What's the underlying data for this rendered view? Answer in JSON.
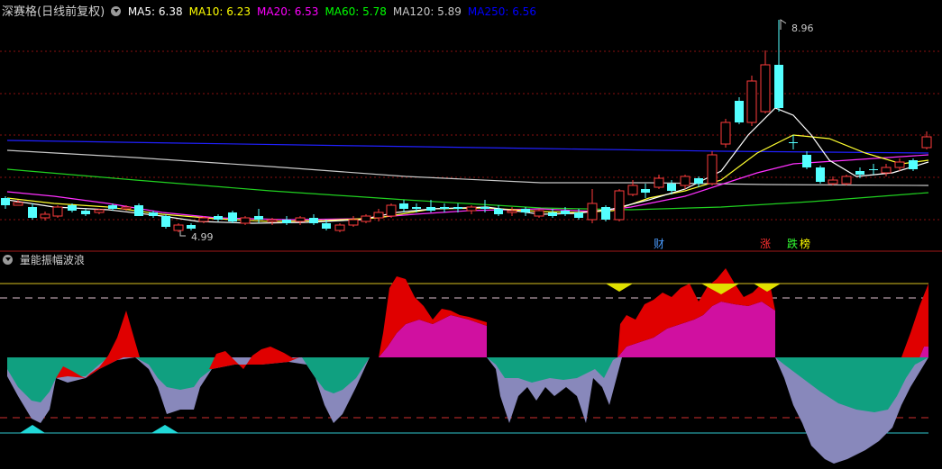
{
  "main": {
    "title": "深赛格(日线前复权)",
    "ma": [
      {
        "name": "MA5",
        "value": "6.38",
        "color": "#ffffff"
      },
      {
        "name": "MA10",
        "value": "6.23",
        "color": "#ffff00"
      },
      {
        "name": "MA20",
        "value": "6.53",
        "color": "#ff00ff"
      },
      {
        "name": "MA60",
        "value": "5.78",
        "color": "#00ff00"
      },
      {
        "name": "MA120",
        "value": "5.89",
        "color": "#c8c8c8"
      },
      {
        "name": "MA250",
        "value": "6.56",
        "color": "#0000ff"
      }
    ],
    "high_label": "8.96",
    "low_label": "4.99",
    "events": [
      {
        "text": "财",
        "color": "#4a9cff"
      },
      {
        "text": "涨",
        "color": "#ff3030"
      },
      {
        "text": "跌",
        "color": "#33ff33"
      },
      {
        "text": "榜",
        "color": "#ffff00"
      }
    ]
  },
  "sub": {
    "title": "量能振幅波浪"
  }
}
